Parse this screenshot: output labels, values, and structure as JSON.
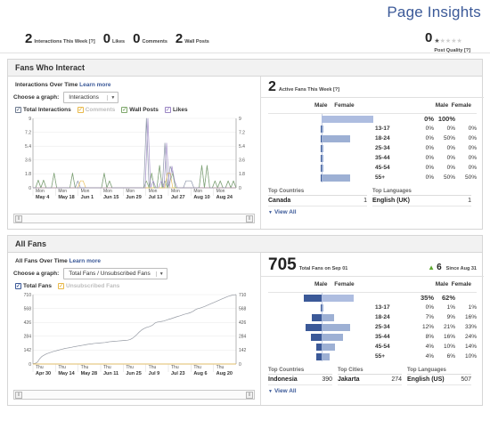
{
  "header": {
    "title": "Page Insights"
  },
  "summary": {
    "stats": [
      {
        "value": "2",
        "label": "Interactions This Week [?]"
      },
      {
        "value": "0",
        "label": "Likes"
      },
      {
        "value": "0",
        "label": "Comments"
      },
      {
        "value": "2",
        "label": "Wall Posts"
      }
    ],
    "quality": {
      "value": "0",
      "label": "Post Quality [?]",
      "stars_filled": 1,
      "stars_total": 5
    }
  },
  "fans_who_interact": {
    "panel_title": "Fans Who Interact",
    "subhead": "Interactions Over Time",
    "learn_more": "Learn more",
    "picker_label": "Choose a graph:",
    "picker_value": "Interactions",
    "legend": [
      {
        "label": "Total Interactions",
        "color": "#6e7b91",
        "checked": true,
        "dim": false
      },
      {
        "label": "Comments",
        "color": "#e8b94a",
        "checked": true,
        "dim": true
      },
      {
        "label": "Wall Posts",
        "color": "#7ea76b",
        "checked": true,
        "dim": false
      },
      {
        "label": "Likes",
        "color": "#9b86c4",
        "checked": true,
        "dim": false
      }
    ],
    "right": {
      "count": "2",
      "count_label": "Active Fans This Week [?]",
      "col_left_m": "Male",
      "col_left_f": "Female",
      "col_right_m": "Male",
      "col_right_f": "Female",
      "total_male_pct": "0%",
      "total_female_pct": "100%",
      "total_male_num": 0,
      "total_female_num": 100,
      "rows": [
        {
          "age": "13-17",
          "male": "0%",
          "female": "0%",
          "extra": "0%",
          "male_num": 0,
          "female_num": 0
        },
        {
          "age": "18-24",
          "male": "0%",
          "female": "50%",
          "extra": "0%",
          "male_num": 0,
          "female_num": 50
        },
        {
          "age": "25-34",
          "male": "0%",
          "female": "0%",
          "extra": "0%",
          "male_num": 0,
          "female_num": 0
        },
        {
          "age": "35-44",
          "male": "0%",
          "female": "0%",
          "extra": "0%",
          "male_num": 0,
          "female_num": 0
        },
        {
          "age": "45-54",
          "male": "0%",
          "female": "0%",
          "extra": "0%",
          "male_num": 0,
          "female_num": 0
        },
        {
          "age": "55+",
          "male": "0%",
          "female": "50%",
          "extra": "50%",
          "male_num": 0,
          "female_num": 50
        }
      ],
      "toplists": [
        {
          "title": "Top Countries",
          "name": "Canada",
          "value": "1"
        },
        {
          "title": "Top Languages",
          "name": "English (UK)",
          "value": "1"
        }
      ],
      "view_all": "View All"
    }
  },
  "all_fans": {
    "panel_title": "All Fans",
    "subhead": "All Fans Over Time",
    "learn_more": "Learn more",
    "picker_label": "Choose a graph:",
    "picker_value": "Total Fans / Unsubscribed Fans",
    "legend": [
      {
        "label": "Total Fans",
        "color": "#3b5998",
        "checked": true,
        "dim": false
      },
      {
        "label": "Unsubscribed Fans",
        "color": "#e8b94a",
        "checked": true,
        "dim": true
      }
    ],
    "right": {
      "count": "705",
      "count_label": "Total Fans on Sep 01",
      "delta": "6",
      "delta_label": "Since Aug 31",
      "col_left_m": "Male",
      "col_left_f": "Female",
      "col_right_m": "Male",
      "col_right_f": "Female",
      "total_male_pct": "35%",
      "total_female_pct": "62%",
      "total_male_num": 35,
      "total_female_num": 62,
      "rows": [
        {
          "age": "13-17",
          "male": "0%",
          "female": "1%",
          "extra": "1%",
          "male_num": 0,
          "female_num": 1
        },
        {
          "age": "18-24",
          "male": "7%",
          "female": "9%",
          "extra": "16%",
          "male_num": 7,
          "female_num": 9
        },
        {
          "age": "25-34",
          "male": "12%",
          "female": "21%",
          "extra": "33%",
          "male_num": 12,
          "female_num": 21
        },
        {
          "age": "35-44",
          "male": "8%",
          "female": "16%",
          "extra": "24%",
          "male_num": 8,
          "female_num": 16
        },
        {
          "age": "45-54",
          "male": "4%",
          "female": "10%",
          "extra": "14%",
          "male_num": 4,
          "female_num": 10
        },
        {
          "age": "55+",
          "male": "4%",
          "female": "6%",
          "extra": "10%",
          "male_num": 4,
          "female_num": 6
        }
      ],
      "toplists": [
        {
          "title": "Top Countries",
          "name": "Indonesia",
          "value": "390"
        },
        {
          "title": "Top Cities",
          "name": "Jakarta",
          "value": "274"
        },
        {
          "title": "Top Languages",
          "name": "English (US)",
          "value": "507"
        }
      ],
      "view_all": "View All"
    }
  },
  "chart_data": [
    {
      "type": "line",
      "title": "Interactions Over Time",
      "xlabel": "",
      "ylabel": "",
      "ylim": [
        0,
        9
      ],
      "yticks": [
        0,
        1.8,
        3.6,
        5.4,
        7.2,
        9
      ],
      "ytick_labels": [
        "0",
        "1.8",
        "3.6",
        "5.4",
        "7.2",
        "9"
      ],
      "grid": true,
      "legend_position": "top",
      "xtick_prefix": "Mon",
      "xtick_labels": [
        "May 4",
        "May 18",
        "Jun 1",
        "Jun 15",
        "Jun 29",
        "Jul 13",
        "Jul 27",
        "Aug 10",
        "Aug 24"
      ],
      "series": [
        {
          "name": "Total Interactions",
          "color": "#7f8aa0",
          "values": [
            0,
            0,
            1,
            0,
            1,
            0,
            0,
            0,
            1.9,
            0,
            0,
            0,
            0,
            0,
            0,
            1.9,
            0,
            0.9,
            0,
            0,
            0,
            0,
            0,
            0,
            0,
            0,
            0,
            1.9,
            0,
            0.9,
            0,
            0,
            0,
            0,
            0,
            0,
            0,
            0,
            0,
            0,
            0,
            0,
            0,
            9,
            0,
            1.9,
            0,
            0,
            2.9,
            0,
            5.8,
            0,
            2.8,
            1.9,
            0,
            0,
            0,
            0,
            0.9,
            0.9,
            0.9,
            0,
            0,
            0,
            2.9,
            0,
            2.9,
            0,
            0,
            0.9,
            0,
            0.9,
            0,
            0,
            0.9,
            0,
            0.9,
            0
          ]
        },
        {
          "name": "Comments",
          "color": "#e8b94a",
          "values": [
            0,
            0,
            0,
            0,
            0,
            0,
            0,
            0,
            0,
            0,
            0,
            0,
            0,
            0,
            0,
            0,
            0,
            0,
            0.9,
            0.9,
            0,
            0,
            0,
            0,
            0,
            0,
            0,
            0,
            0,
            0,
            0,
            0,
            0,
            0,
            0,
            0,
            0,
            0,
            0,
            0,
            0,
            0,
            0,
            0,
            0,
            0,
            0,
            0,
            0,
            0,
            0,
            1.9,
            1.9,
            0,
            0,
            0,
            0,
            0,
            0,
            0,
            0,
            0,
            0,
            0,
            0,
            0,
            0,
            0,
            0,
            0,
            0,
            0,
            0,
            0,
            0,
            0,
            0,
            0
          ]
        },
        {
          "name": "Wall Posts",
          "color": "#7ea76b",
          "values": [
            0,
            0,
            1,
            0,
            1,
            0,
            0,
            0,
            1.9,
            0,
            0,
            0,
            0,
            0,
            0,
            1.9,
            0,
            0,
            0,
            0,
            0,
            0,
            0,
            0,
            0,
            0,
            0,
            1.9,
            0,
            0.9,
            0,
            0,
            0,
            0,
            0,
            0,
            0,
            0,
            0,
            0,
            0,
            0,
            0,
            0.9,
            0,
            1.9,
            0,
            0,
            2.9,
            0,
            0.9,
            0,
            0.9,
            1.9,
            0,
            0,
            0,
            0,
            0,
            0,
            0,
            0,
            0,
            0,
            2.9,
            0,
            2.9,
            0,
            0,
            0.9,
            0,
            0.9,
            0,
            0,
            0.9,
            0,
            0.9,
            0
          ]
        },
        {
          "name": "Likes",
          "color": "#9b86c4",
          "values": [
            0,
            0,
            0,
            0,
            0,
            0,
            0,
            0,
            0,
            0,
            0,
            0,
            0,
            0,
            0,
            0,
            0,
            0,
            0,
            0,
            0,
            0,
            0,
            0,
            0,
            0,
            0,
            0,
            0,
            0,
            0,
            0,
            0,
            0,
            0,
            0,
            0,
            0,
            0,
            0,
            0,
            0,
            0,
            9,
            0,
            0.9,
            0,
            0,
            0.9,
            0,
            5.8,
            0,
            2.8,
            0.9,
            0,
            0,
            0,
            0,
            0,
            0,
            0,
            0,
            0,
            0,
            0,
            0,
            0,
            0,
            0,
            0,
            0,
            0,
            0,
            0,
            0,
            0,
            0
          ]
        }
      ]
    },
    {
      "type": "line",
      "title": "All Fans Over Time",
      "xlabel": "",
      "ylabel": "",
      "ylim": [
        0,
        710
      ],
      "yticks": [
        0,
        142,
        284,
        426,
        568,
        710
      ],
      "ytick_labels": [
        "0",
        "142",
        "284",
        "426",
        "568",
        "710"
      ],
      "grid": true,
      "legend_position": "top",
      "xtick_prefix": "Thu",
      "xtick_labels": [
        "Apr 30",
        "May 14",
        "May 28",
        "Jun 11",
        "Jun 25",
        "Jul 9",
        "Jul 23",
        "Aug 6",
        "Aug 20"
      ],
      "series": [
        {
          "name": "Total Fans",
          "color": "#8a8f99",
          "values": [
            2,
            6,
            20,
            55,
            78,
            92,
            104,
            112,
            120,
            128,
            134,
            140,
            146,
            152,
            158,
            162,
            166,
            170,
            176,
            180,
            184,
            188,
            192,
            196,
            200,
            204,
            206,
            210,
            212,
            214,
            216,
            218,
            220,
            224,
            228,
            230,
            232,
            234,
            236,
            238,
            240,
            242,
            244,
            250,
            262,
            280,
            300,
            325,
            345,
            360,
            372,
            378,
            386,
            398,
            418,
            428,
            432,
            436,
            440,
            448,
            456,
            462,
            470,
            478,
            486,
            492,
            500,
            508,
            514,
            520,
            528,
            540,
            556,
            566,
            572,
            580,
            588,
            598,
            608,
            618,
            628,
            638,
            648,
            658,
            668,
            678,
            688,
            696,
            702,
            706,
            710
          ]
        },
        {
          "name": "Unsubscribed Fans",
          "color": "#e8b94a",
          "values": [
            0,
            0,
            0,
            0,
            0,
            0,
            0,
            0,
            0,
            0,
            0,
            0,
            0,
            0,
            0,
            0,
            0,
            0,
            0,
            0,
            0,
            0,
            0,
            0,
            0,
            0,
            0,
            0,
            0,
            0,
            0,
            0,
            0,
            0,
            0,
            0,
            0,
            0,
            0,
            0,
            0,
            0,
            0,
            0,
            0,
            0,
            0,
            0,
            0,
            0,
            0,
            0,
            0,
            0,
            0,
            0,
            0,
            0,
            0,
            0,
            0,
            0,
            0,
            0,
            0,
            0,
            0,
            0,
            0,
            0,
            0,
            0,
            0,
            0,
            0,
            0,
            0,
            0,
            0,
            0,
            0,
            0,
            0,
            0,
            0,
            0,
            0,
            0,
            0,
            0,
            0
          ]
        }
      ]
    }
  ]
}
